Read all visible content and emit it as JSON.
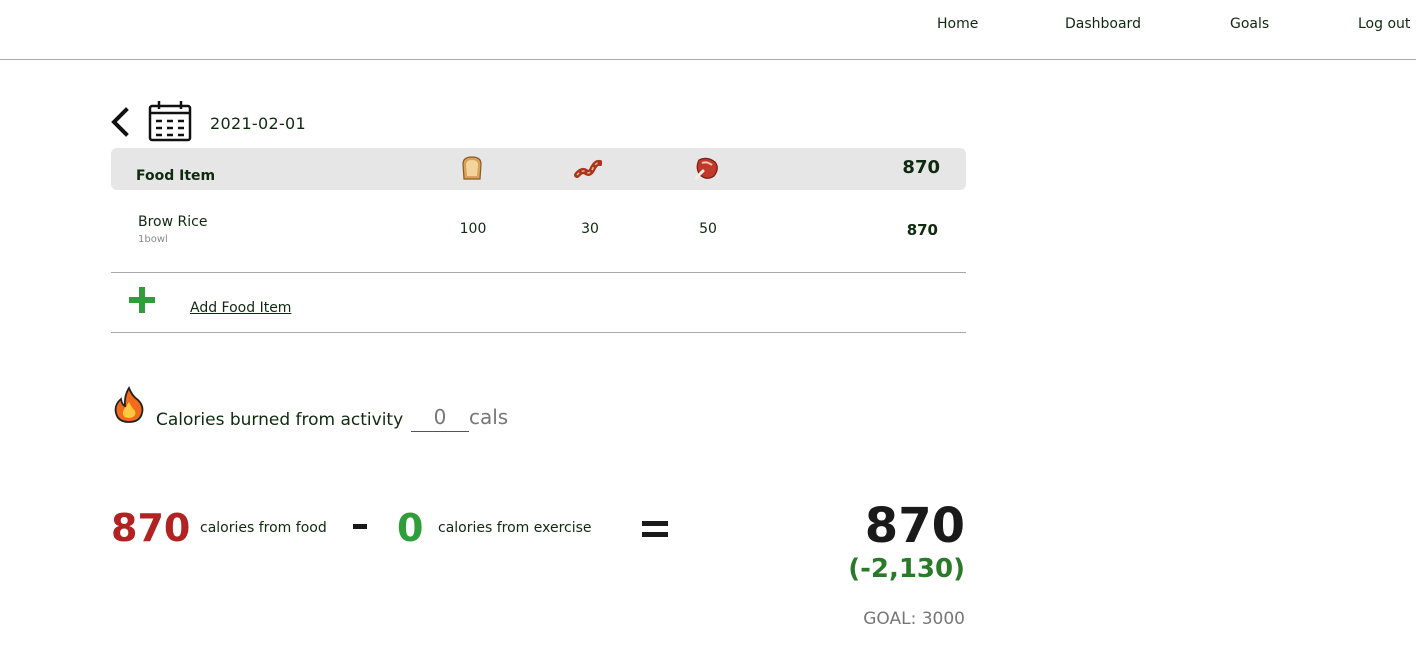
{
  "nav": {
    "home": "Home",
    "dashboard": "Dashboard",
    "goals": "Goals",
    "logout": "Log out"
  },
  "date": "2021-02-01",
  "table": {
    "header_label": "Food Item",
    "header_icons": [
      "bread-icon",
      "bacon-icon",
      "meat-icon"
    ],
    "header_total": "870",
    "rows": [
      {
        "name": "Brow Rice",
        "serving": "1bowl",
        "carbs": "100",
        "fat": "30",
        "protein": "50",
        "calories": "870"
      }
    ]
  },
  "add_food_label": "Add Food Item",
  "activity": {
    "label": "Calories burned from activity",
    "value": "0",
    "unit": "cals"
  },
  "summary": {
    "food_calories": "870",
    "food_label": "calories from food",
    "exercise_calories": "0",
    "exercise_label": "calories from exercise",
    "net": "870",
    "difference": "(-2,130)",
    "goal": "GOAL: 3000"
  },
  "colors": {
    "food": "#b22222",
    "exercise": "#2f9e3a",
    "difference": "#2a7a2a",
    "accent_text": "#0f2a0f"
  }
}
